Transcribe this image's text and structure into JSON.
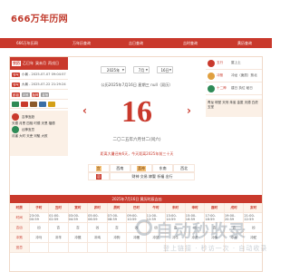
{
  "site": {
    "logo": "666万年历网"
  },
  "nav": [
    "666万年历网",
    "万年历查询",
    "吉日查询",
    "吉时查询",
    "黄历查询"
  ],
  "left": {
    "header": {
      "tag": "农历",
      "a": "乙巳年",
      "b": "癸未月",
      "c": "丙戌日"
    },
    "rows": [
      {
        "tag": "节气",
        "text": "小暑 - 2025-07-07 09:04:57"
      },
      {
        "tag": "节气",
        "text": "大暑 - 2025-07-22 21:29:24"
      }
    ],
    "tags_row": [
      "彭祖",
      "冲煞",
      "胎神",
      "星宿"
    ],
    "gods": {
      "title": "吉神宜趋",
      "l1": "天德 月恩 四相 时德 天恩 福德",
      "l2": "凶神宜忌",
      "l3": "月害 大时 天吏 河魁 大败"
    }
  },
  "center": {
    "year": "2025年",
    "month": "7月",
    "day": "16日",
    "solar": "公历2025年7月16日  星期三  null（双历）",
    "big_day": "16",
    "lunar": "二〇二五年六月廿二(闰六)",
    "jieqi": "距离大暑还有6天，今天距离2025年前三十天",
    "yj_row1": [
      "宜",
      "西南",
      "喜神",
      "东南",
      "西北"
    ],
    "yj_row2": [
      "忌",
      "财神 交易 嫁娶 祈福 出行"
    ]
  },
  "right": {
    "rows": [
      {
        "label": "五行",
        "val": "屋上土",
        "color": "red"
      },
      {
        "label": "冲煞",
        "val": "冲龙（庚辰）煞北",
        "color": "gold"
      },
      {
        "label": "十二神",
        "val": "建日 执位 破日",
        "color": "green"
      }
    ],
    "box": "青龙 明堂 天刑 朱雀 金匮 天德 白虎 玉堂"
  },
  "hours": {
    "title": "2025年7月16日 黄历时辰吉凶",
    "head": [
      "时辰",
      "子时",
      "丑时",
      "寅时",
      "卯时",
      "辰时",
      "巳时",
      "午时",
      "未时",
      "申时",
      "酉时",
      "戌时",
      "亥时"
    ],
    "rows": [
      [
        "时间",
        "23:00-00:59",
        "01:00-02:59",
        "03:00-04:59",
        "05:00-06:59",
        "07:00-08:59",
        "09:00-10:59",
        "11:00-12:59",
        "13:00-14:59",
        "15:00-16:59",
        "17:00-18:59",
        "19:00-20:59",
        "21:00-22:59"
      ],
      [
        "吉凶",
        "凶",
        "吉",
        "吉",
        "凶",
        "吉",
        "凶",
        "凶",
        "吉",
        "凶",
        "吉",
        "吉",
        "凶"
      ],
      [
        "冲煞",
        "冲马",
        "冲羊",
        "冲猴",
        "冲鸡",
        "冲狗",
        "冲猪",
        "冲鼠",
        "冲牛",
        "冲虎",
        "冲兔",
        "冲龙",
        "冲蛇"
      ],
      [
        "宜忌",
        "",
        "",
        "",
        "",
        "",
        "",
        "",
        "",
        "",
        "",
        "",
        ""
      ]
    ]
  },
  "watermark": {
    "main": "自动秒收录",
    "sub": "登上链接 · 秒访一次 · 自动收录"
  }
}
